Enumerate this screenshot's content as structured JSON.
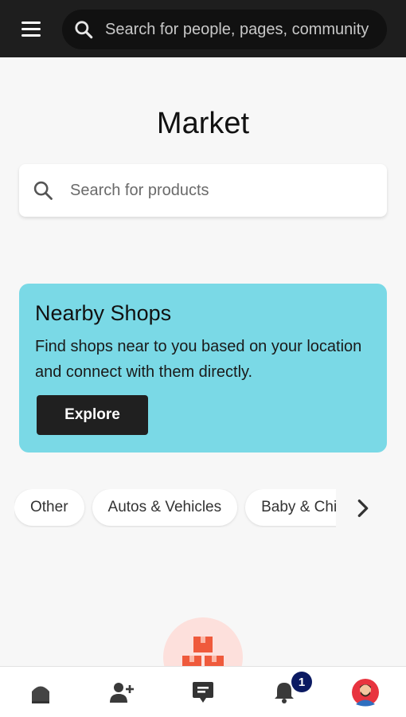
{
  "topbar": {
    "search_placeholder": "Search for people, pages, community",
    "menu_icon": "hamburger-menu-icon",
    "search_icon": "search-icon"
  },
  "page": {
    "title": "Market"
  },
  "product_search": {
    "placeholder": "Search for products",
    "icon": "search-icon"
  },
  "promo": {
    "title": "Nearby Shops",
    "text": "Find shops near to you based on your location and connect with them directly.",
    "button_label": "Explore",
    "background": "#7ad9e6"
  },
  "categories": [
    {
      "label": "Other"
    },
    {
      "label": "Autos & Vehicles"
    },
    {
      "label": "Baby & Children"
    }
  ],
  "bottom_nav": {
    "items": [
      {
        "icon": "home-icon"
      },
      {
        "icon": "add-friend-icon"
      },
      {
        "icon": "messages-icon"
      },
      {
        "icon": "notifications-icon",
        "badge": "1"
      },
      {
        "icon": "profile-avatar"
      }
    ]
  },
  "colors": {
    "topbar": "#1e1e1e",
    "accent_badge": "#0b1a62",
    "illustration": "#ef5a3c"
  }
}
